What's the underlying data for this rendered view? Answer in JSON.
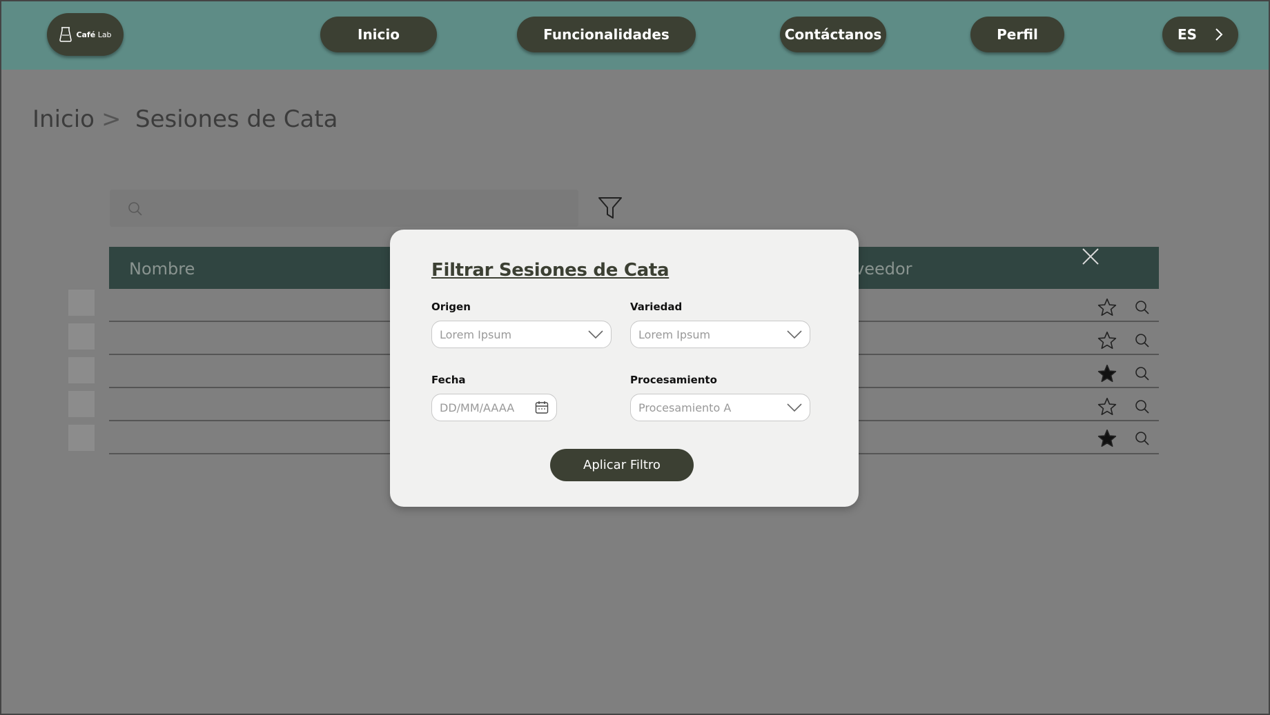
{
  "header": {
    "logo_text_bold": "Café",
    "logo_text": "Lab",
    "nav": [
      "Inicio",
      "Funcionalidades",
      "Contáctanos",
      "Perfil"
    ],
    "language": "ES"
  },
  "breadcrumb": {
    "home": "Inicio",
    "separator": ">",
    "current": "Sesiones de Cata"
  },
  "search": {
    "placeholder": ""
  },
  "table": {
    "columns": [
      "Nombre",
      "veedor"
    ],
    "rows": [
      {
        "favorite": false
      },
      {
        "favorite": false
      },
      {
        "favorite": true
      },
      {
        "favorite": false
      },
      {
        "favorite": true
      }
    ]
  },
  "modal": {
    "title": "Filtrar Sesiones de Cata",
    "origen": {
      "label": "Origen",
      "value": "Lorem Ipsum"
    },
    "variedad": {
      "label": "Variedad",
      "value": "Lorem Ipsum"
    },
    "fecha": {
      "label": "Fecha",
      "placeholder": "DD/MM/AAAA"
    },
    "procesamiento": {
      "label": "Procesamiento",
      "value": "Procesamiento A"
    },
    "apply_label": "Aplicar Filtro"
  },
  "colors": {
    "header": "#5e8c86",
    "pill": "#3c4033",
    "table_header": "#304541",
    "overlay": "#7f7f7f",
    "modal_bg": "#f1f1f0"
  }
}
